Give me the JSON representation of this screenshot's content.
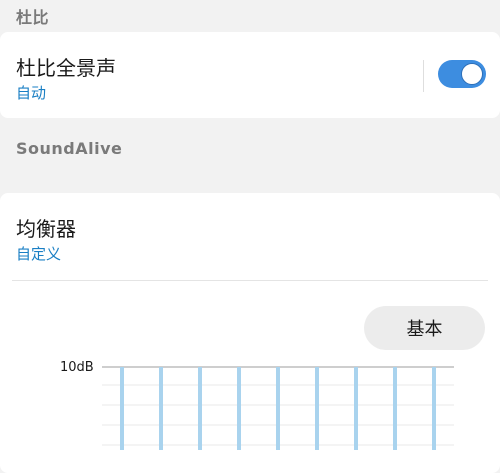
{
  "dolby_section": {
    "header": "杜比"
  },
  "dolby_atmos": {
    "title": "杜比全景声",
    "subtitle": "自动",
    "toggle_on": true,
    "toggle_color": "#3d8de0"
  },
  "soundalive_section": {
    "header": "SoundAlive"
  },
  "equalizer": {
    "title": "均衡器",
    "subtitle": "自定义",
    "preset_label": "基本",
    "top_label": "10dB",
    "band_count": 9,
    "bar_color": "#a9d3ee"
  },
  "colors": {
    "accent_text": "#1a7fc4",
    "background": "#f2f2f2",
    "card": "#ffffff"
  }
}
